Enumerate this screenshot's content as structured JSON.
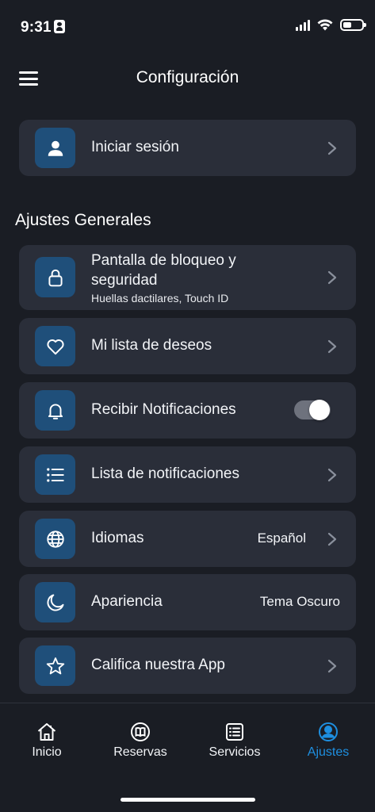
{
  "status": {
    "time": "9:31"
  },
  "header": {
    "title": "Configuración"
  },
  "login": {
    "label": "Iniciar sesión",
    "icon": "user-icon"
  },
  "section": {
    "title": "Ajustes Generales"
  },
  "items": [
    {
      "label": "Pantalla de bloqueo y seguridad",
      "sub": "Huellas dactilares, Touch ID",
      "icon": "lock-icon"
    },
    {
      "label": "Mi lista de deseos",
      "icon": "heart-icon"
    },
    {
      "label": "Recibir Notificaciones",
      "icon": "bell-icon",
      "toggle_on": true
    },
    {
      "label": "Lista de notificaciones",
      "icon": "list-icon"
    },
    {
      "label": "Idiomas",
      "value": "Español",
      "icon": "globe-icon"
    },
    {
      "label": "Apariencia",
      "value": "Tema Oscuro",
      "icon": "moon-icon"
    },
    {
      "label": "Califica nuestra App",
      "icon": "star-icon"
    }
  ],
  "tabs": [
    {
      "label": "Inicio",
      "icon": "home-icon"
    },
    {
      "label": "Reservas",
      "icon": "book-icon"
    },
    {
      "label": "Servicios",
      "icon": "services-icon"
    },
    {
      "label": "Ajustes",
      "icon": "profile-icon",
      "active": true
    }
  ],
  "colors": {
    "background": "#1a1d24",
    "card": "#2a2e39",
    "icon_tile": "#1f4f7a",
    "accent": "#1e8fe0"
  }
}
